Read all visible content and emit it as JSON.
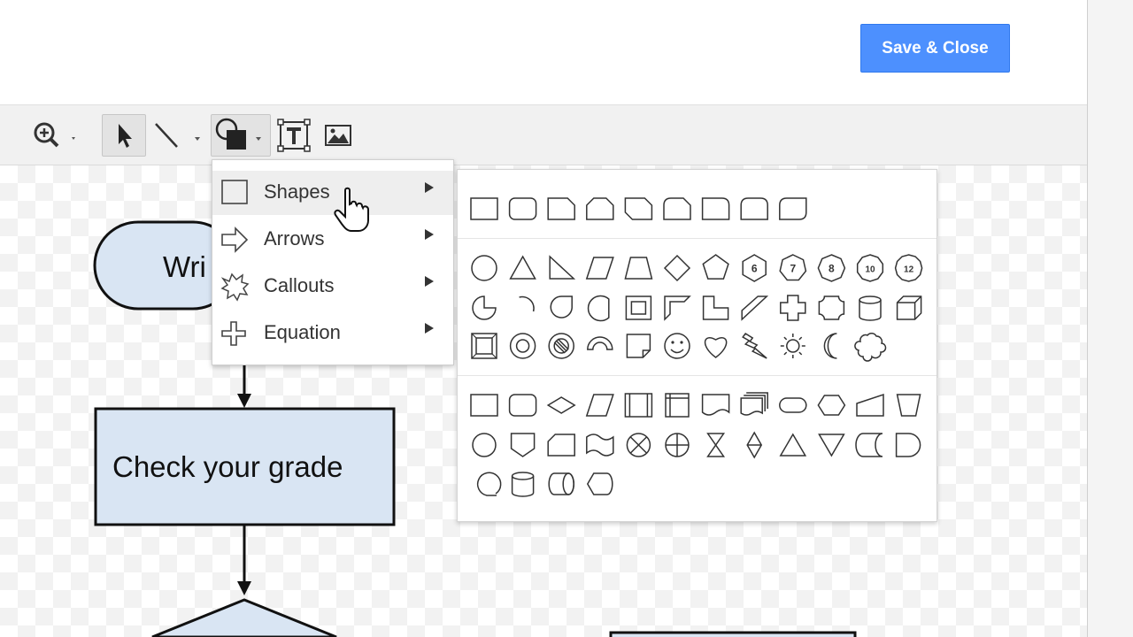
{
  "header": {
    "save_close_label": "Save & Close"
  },
  "toolbar": {
    "zoom_icon": "zoom-icon",
    "select_icon": "select-arrow-icon",
    "line_icon": "line-icon",
    "shape_icon": "shape-icon",
    "textbox_icon": "textbox-icon",
    "image_icon": "image-icon"
  },
  "canvas": {
    "terminator_label": "Wri",
    "process_label": "Check your grade"
  },
  "shape_menu": {
    "items": [
      {
        "label": "Shapes",
        "icon": "rectangle-outline-icon"
      },
      {
        "label": "Arrows",
        "icon": "arrow-outline-icon"
      },
      {
        "label": "Callouts",
        "icon": "explosion-callout-icon"
      },
      {
        "label": "Equation",
        "icon": "plus-outline-icon"
      }
    ]
  },
  "shapes_palette": {
    "rectangles": [
      "rectangle",
      "rounded-rectangle",
      "snip-corner-rectangle",
      "snip-same-side-rectangle",
      "snip-diagonal-rectangle",
      "snip-round-rectangle",
      "round-corner-rectangle",
      "round-same-side-rectangle",
      "round-diagonal-rectangle"
    ],
    "basic_row1": [
      "ellipse",
      "triangle",
      "right-triangle",
      "parallelogram",
      "trapezoid",
      "diamond",
      "pentagon",
      "hexagon",
      "heptagon",
      "octagon",
      "decagon",
      "dodecagon"
    ],
    "basic_row1_labels": [
      "6",
      "7",
      "8",
      "10",
      "12"
    ],
    "basic_row2": [
      "pie",
      "arc",
      "teardrop",
      "chord",
      "frame",
      "half-frame",
      "l-shape",
      "diagonal-stripe",
      "cross",
      "plaque",
      "can",
      "cube"
    ],
    "basic_row3": [
      "bevel",
      "donut",
      "no-symbol",
      "block-arc",
      "folded-corner",
      "smiley",
      "heart",
      "lightning",
      "sun",
      "moon",
      "cloud"
    ],
    "flowchart_row1": [
      "process",
      "alternate-process",
      "decision",
      "data",
      "predefined-process",
      "internal-storage",
      "document",
      "multidocument",
      "terminator",
      "preparation",
      "manual-input",
      "manual-operation"
    ],
    "flowchart_row2": [
      "connector",
      "off-page-connector",
      "card",
      "punched-tape",
      "summing-junction",
      "or",
      "collate",
      "sort",
      "extract",
      "merge",
      "stored-data",
      "delay"
    ],
    "flowchart_row3": [
      "sequential-access-storage",
      "magnetic-disk",
      "direct-access-storage",
      "display"
    ]
  }
}
